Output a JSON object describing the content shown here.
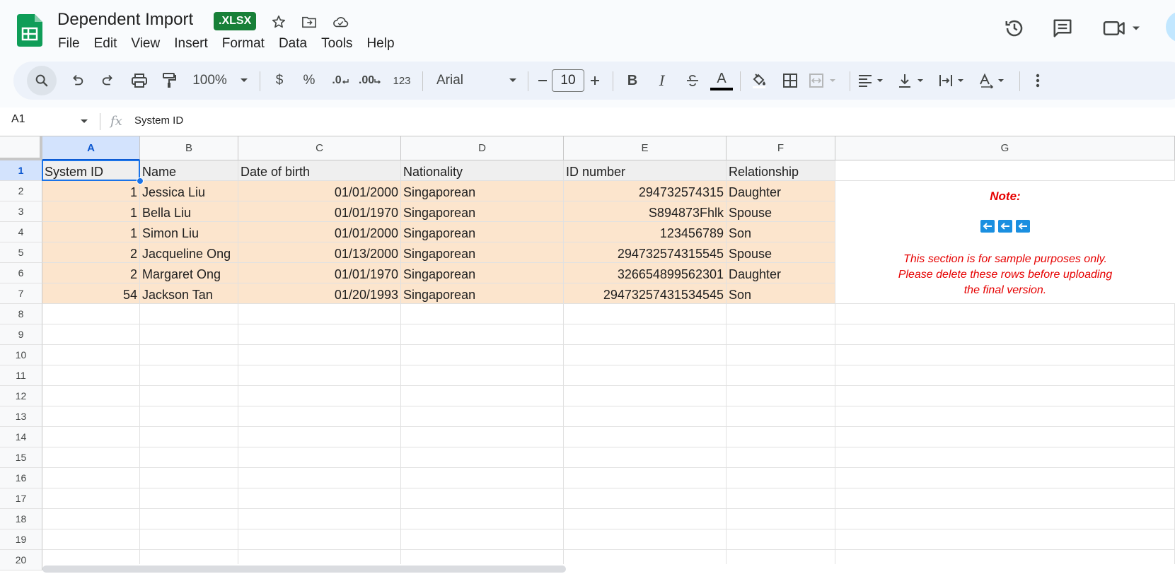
{
  "document": {
    "title": "Dependent Import",
    "format_badge": ".XLSX"
  },
  "menu": [
    "File",
    "Edit",
    "View",
    "Insert",
    "Format",
    "Data",
    "Tools",
    "Help"
  ],
  "toolbar": {
    "zoom": "100%",
    "currency": "$",
    "percent": "%",
    "decrease_decimal": ".0",
    "increase_decimal": ".00",
    "number_format": "123",
    "font": "Arial",
    "font_size": "10",
    "text_color": "#000000",
    "accent_color": "#188038"
  },
  "formula_bar": {
    "name_box": "A1",
    "fx": "fx",
    "value": "System ID"
  },
  "sheet": {
    "columns": [
      "A",
      "B",
      "C",
      "D",
      "E",
      "F",
      "G"
    ],
    "selected_column": "A",
    "row_numbers": [
      "1",
      "2",
      "3",
      "4",
      "5",
      "6",
      "7",
      "8",
      "9",
      "10",
      "11",
      "12",
      "13",
      "14",
      "15",
      "16",
      "17",
      "18",
      "19",
      "20"
    ],
    "selected_row": "1",
    "header_row": [
      "System ID",
      "Name",
      "Date of birth",
      "Nationality",
      "ID number",
      "Relationship"
    ],
    "rows": [
      [
        "1",
        "Jessica Liu",
        "01/01/2000",
        "Singaporean",
        "294732574315",
        "Daughter"
      ],
      [
        "1",
        "Bella Liu",
        "01/01/1970",
        "Singaporean",
        "S894873Fhlk",
        "Spouse"
      ],
      [
        "1",
        "Simon Liu",
        "01/01/2000",
        "Singaporean",
        "123456789",
        "Son"
      ],
      [
        "2",
        "Jacqueline Ong",
        "01/13/2000",
        "Singaporean",
        "294732574315545",
        "Spouse"
      ],
      [
        "2",
        "Margaret Ong",
        "01/01/1970",
        "Singaporean",
        "326654899562301",
        "Daughter"
      ],
      [
        "54",
        "Jackson Tan",
        "01/20/1993",
        "Singaporean",
        "29473257431534545",
        "Son"
      ]
    ],
    "data_fill_color": "#fce5cd",
    "header_fill_color": "#efefef"
  },
  "note": {
    "title": "Note:",
    "arrow_count": 3,
    "text": "This section is for sample purposes only.\nPlease delete these rows before uploading\nthe final version.",
    "color": "#e60000"
  }
}
